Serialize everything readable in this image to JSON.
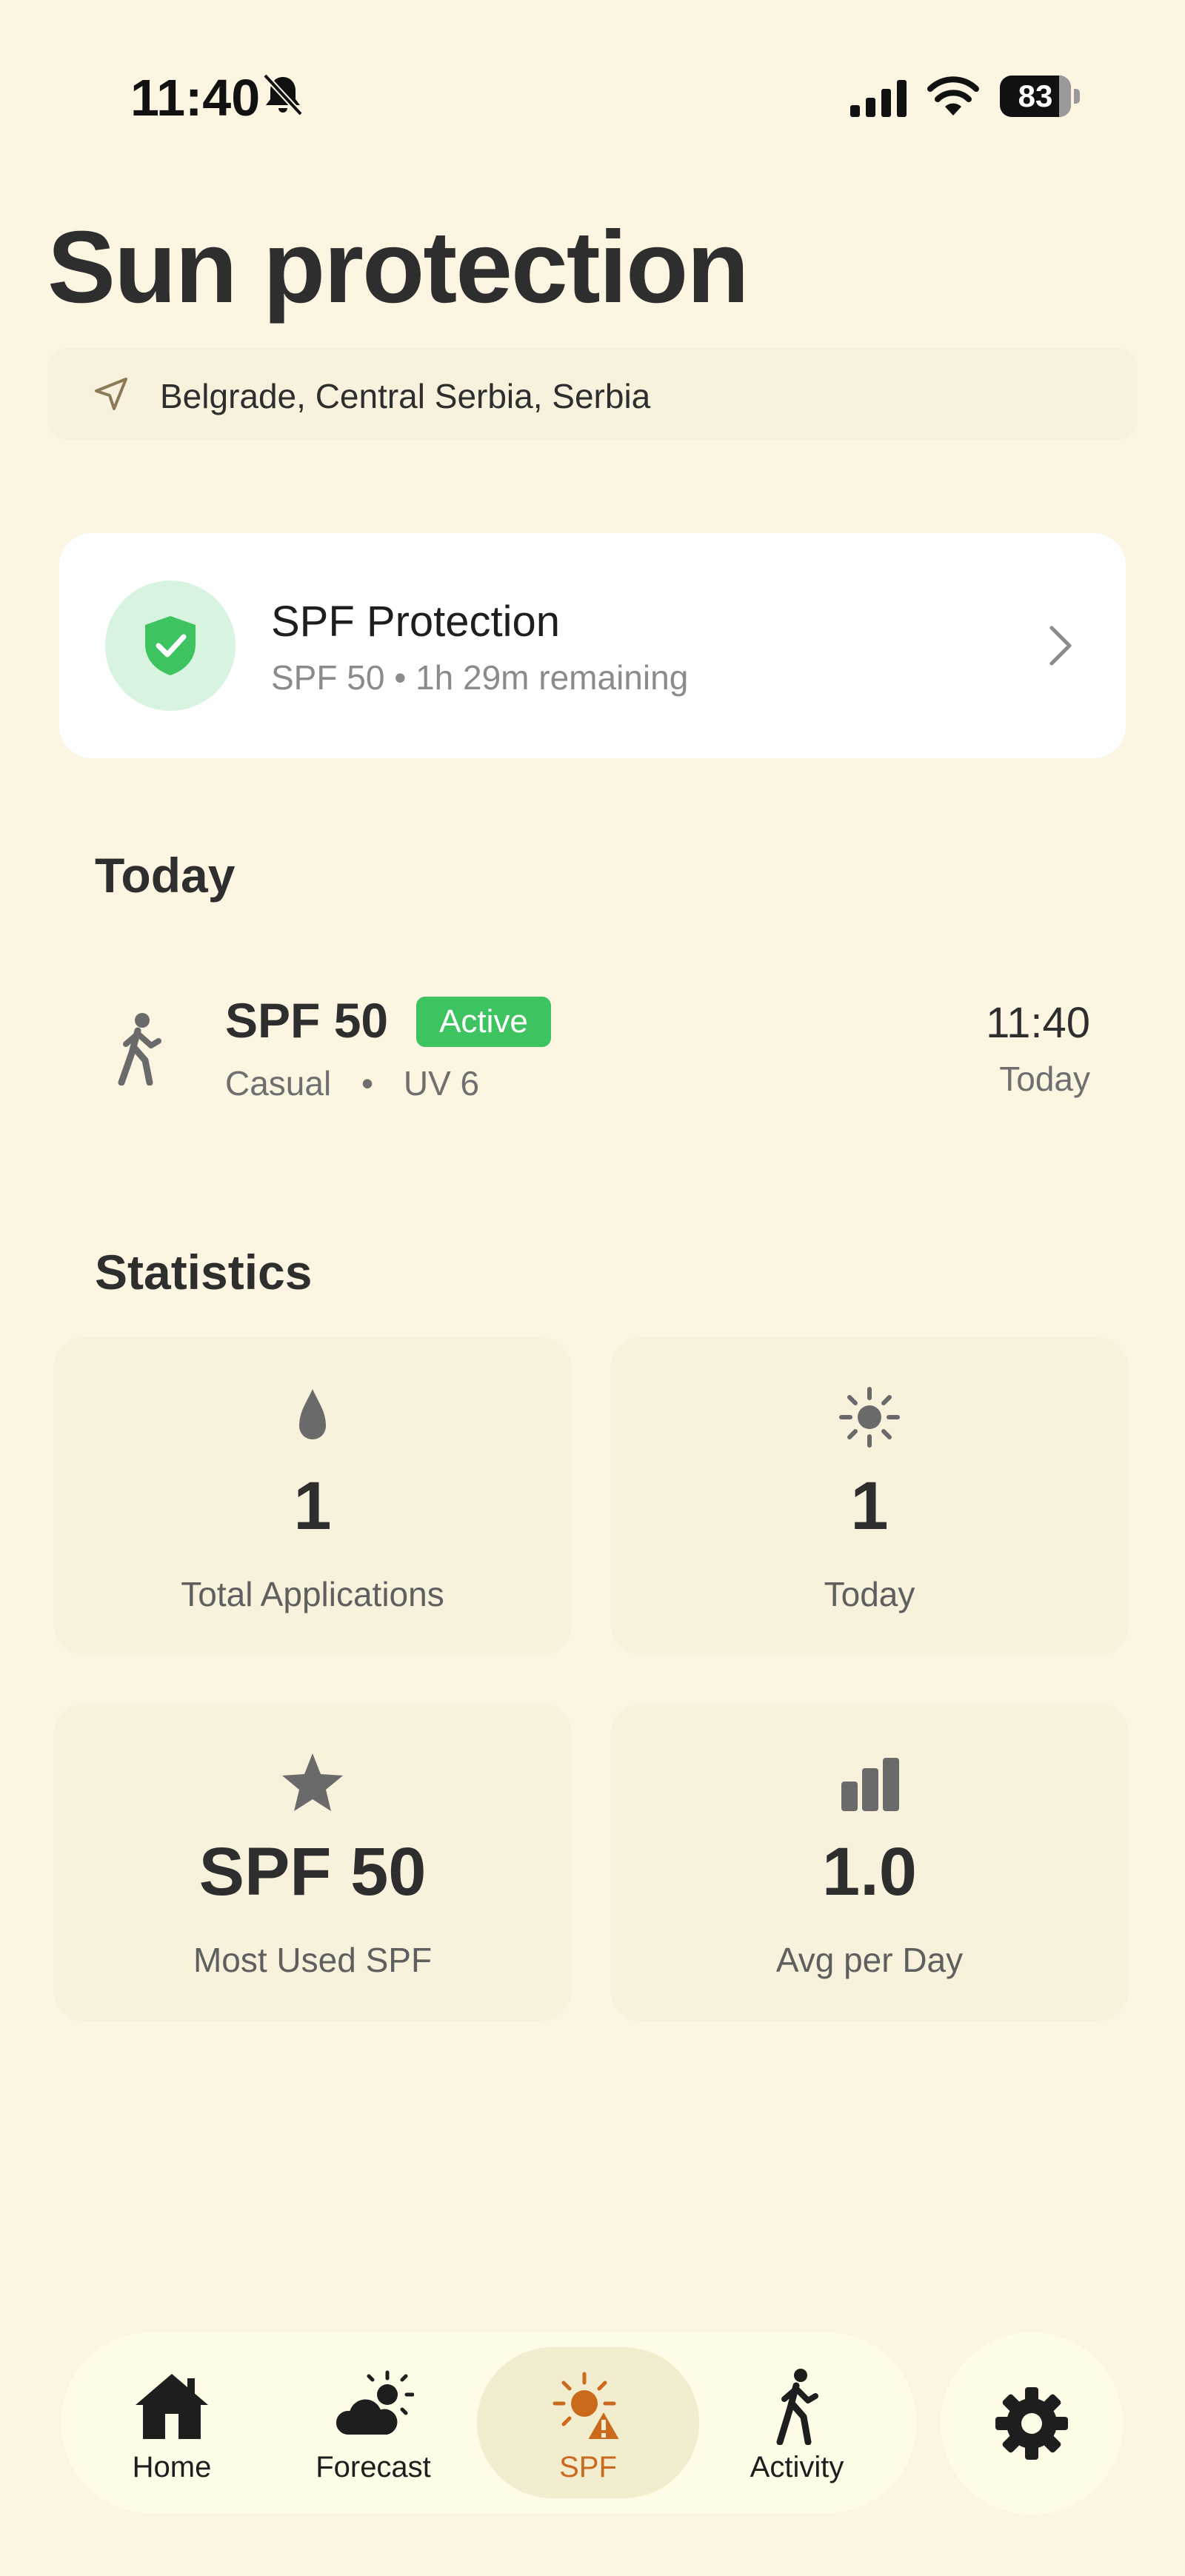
{
  "status_bar": {
    "time": "11:40",
    "battery": "83",
    "icons": [
      "bell-slash-icon",
      "signal-icon",
      "wifi-icon",
      "battery-icon"
    ]
  },
  "header": {
    "title": "Sun protection",
    "location": "Belgrade, Central Serbia, Serbia"
  },
  "spf_card": {
    "title": "SPF Protection",
    "subtitle": "SPF 50 • 1h 29m remaining",
    "icon": "shield-check-icon",
    "accent": "#3dc35f"
  },
  "today": {
    "heading": "Today",
    "entries": [
      {
        "spf": "SPF 50",
        "badge": "Active",
        "activity": "Casual",
        "uv": "UV 6",
        "time": "11:40",
        "day": "Today",
        "icon": "walking-icon"
      }
    ]
  },
  "statistics": {
    "heading": "Statistics",
    "cards": [
      {
        "value": "1",
        "label": "Total Applications",
        "icon": "drop-icon"
      },
      {
        "value": "1",
        "label": "Today",
        "icon": "sun-icon"
      },
      {
        "value": "SPF 50",
        "label": "Most Used SPF",
        "icon": "star-icon"
      },
      {
        "value": "1.0",
        "label": "Avg per Day",
        "icon": "bar-chart-icon"
      }
    ]
  },
  "tabbar": {
    "tabs": [
      {
        "label": "Home",
        "icon": "house-icon"
      },
      {
        "label": "Forecast",
        "icon": "cloud-sun-icon"
      },
      {
        "label": "SPF",
        "icon": "sun-warning-icon",
        "active": true
      },
      {
        "label": "Activity",
        "icon": "walking-icon"
      }
    ],
    "settings_icon": "gear-icon",
    "active_color": "#c96a1c"
  }
}
